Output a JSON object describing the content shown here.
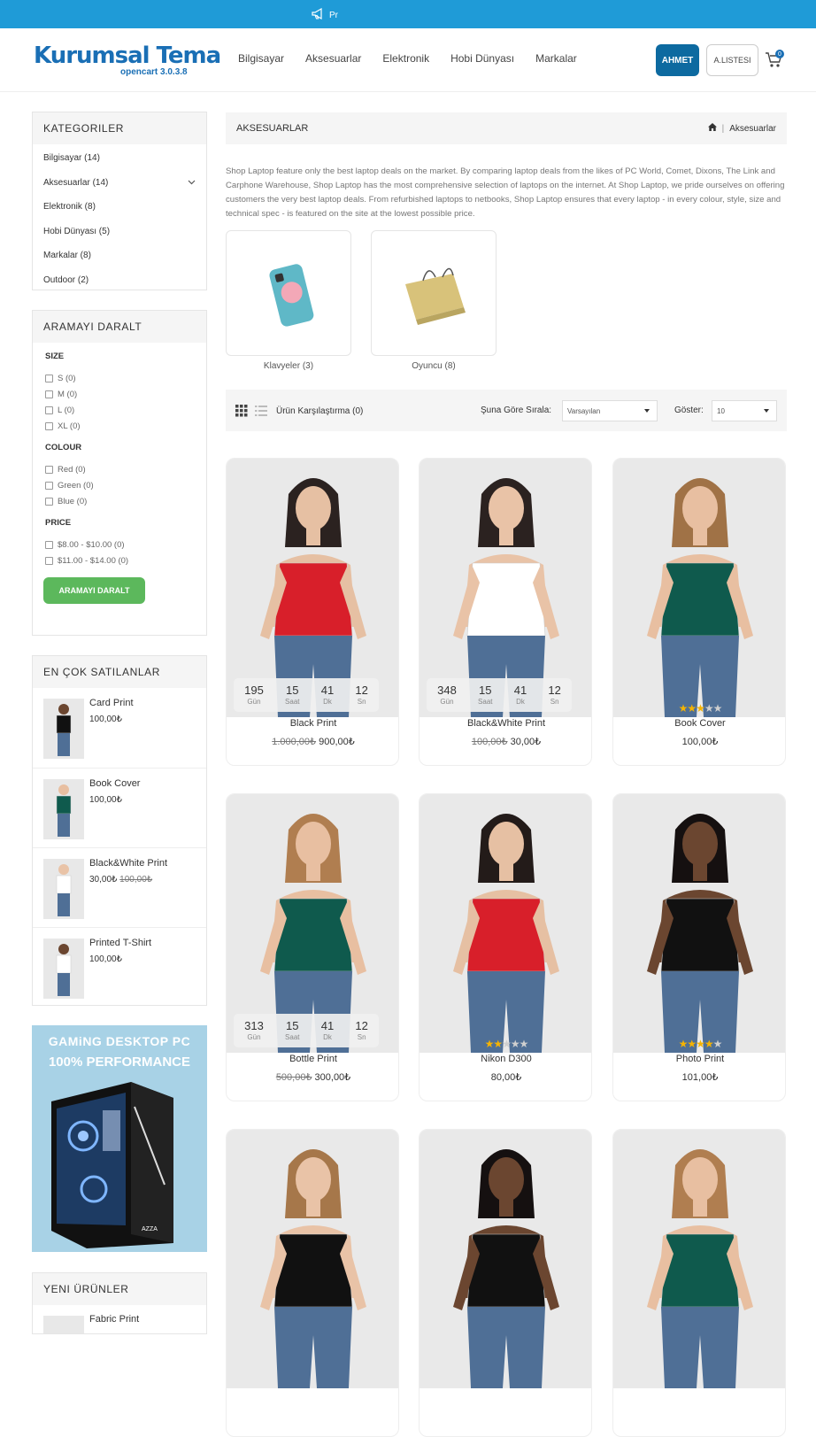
{
  "announcement": {
    "text": "Pr"
  },
  "logo": {
    "main": "Kurumsal Tema",
    "sub": "opencart 3.0.3.8"
  },
  "nav": [
    "Bilgisayar",
    "Aksesuarlar",
    "Elektronik",
    "Hobi Dünyası",
    "Markalar"
  ],
  "header": {
    "user_label": "AHMET",
    "wishlist_label": "A.LISTESI",
    "cart_count": "0"
  },
  "categories": {
    "title": "KATEGORILER",
    "items": [
      "Bilgisayar (14)",
      "Aksesuarlar (14)",
      "Elektronik (8)",
      "Hobi Dünyası (5)",
      "Markalar (8)",
      "Outdoor (2)"
    ]
  },
  "filter": {
    "title": "ARAMAYI DARALT",
    "groups": [
      {
        "title": "SIZE",
        "options": [
          "S (0)",
          "M (0)",
          "L (0)",
          "XL (0)"
        ]
      },
      {
        "title": "COLOUR",
        "options": [
          "Red (0)",
          "Green (0)",
          "Blue (0)"
        ]
      },
      {
        "title": "PRICE",
        "options": [
          "$8.00 - $10.00 (0)",
          "$11.00 - $14.00 (0)"
        ]
      }
    ],
    "button": "ARAMAYI DARALT"
  },
  "bestsellers": {
    "title": "EN ÇOK SATILANLAR",
    "items": [
      {
        "name": "Card Print",
        "price": "100,00₺",
        "old": ""
      },
      {
        "name": "Book Cover",
        "price": "100,00₺",
        "old": ""
      },
      {
        "name": "Black&White Print",
        "price": "30,00₺",
        "old": "100,00₺"
      },
      {
        "name": "Printed T-Shirt",
        "price": "100,00₺",
        "old": ""
      }
    ]
  },
  "banner": {
    "line1": "GAMiNG DESKTOP PC",
    "line2": "100% PERFORMANCE"
  },
  "new_products": {
    "title": "YENI ÜRÜNLER",
    "first": "Fabric Print"
  },
  "breadcrumb": {
    "title": "AKSESUARLAR",
    "current": "Aksesuarlar"
  },
  "description": "Shop Laptop feature only the best laptop deals on the market. By comparing laptop deals from the likes of PC World, Comet, Dixons, The Link and Carphone Warehouse, Shop Laptop has the most comprehensive selection of laptops on the internet. At Shop Laptop, we pride ourselves on offering customers the very best laptop deals. From refurbished laptops to netbooks, Shop Laptop ensures that every laptop - in every colour, style, size and technical spec - is featured on the site at the lowest possible price.",
  "subcategories": [
    "Klavyeler (3)",
    "Oyuncu (8)"
  ],
  "toolbar": {
    "compare": "Ürün Karşılaştırma (0)",
    "sort_label": "Şuna Göre Sırala:",
    "sort_value": "Varsayılan",
    "show_label": "Göster:",
    "show_value": "10"
  },
  "countdown_labels": [
    "Gün",
    "Saat",
    "Dk",
    "Sn"
  ],
  "products": [
    {
      "name": "Black Print",
      "old": "1.000,00₺",
      "price": "900,00₺",
      "countdown": [
        "195",
        "15",
        "41",
        "12"
      ],
      "rating": null,
      "top": "#e9e9e9",
      "shirt": "#d81f2a",
      "skin": "#e6c0a3",
      "hair": "#2b2220"
    },
    {
      "name": "Black&White Print",
      "old": "100,00₺",
      "price": "30,00₺",
      "countdown": [
        "348",
        "15",
        "41",
        "12"
      ],
      "rating": null,
      "top": "#e9e9e9",
      "shirt": "#ffffff",
      "skin": "#e9c3a7",
      "hair": "#2b2220"
    },
    {
      "name": "Book Cover",
      "old": "",
      "price": "100,00₺",
      "countdown": null,
      "rating": 3,
      "top": "#e9e9e9",
      "shirt": "#0f5a4d",
      "skin": "#e8bfa1",
      "hair": "#a07246"
    },
    {
      "name": "Bottle Print",
      "old": "500,00₺",
      "price": "300,00₺",
      "countdown": [
        "313",
        "15",
        "41",
        "12"
      ],
      "rating": null,
      "top": "#e9e9e9",
      "shirt": "#0f5a4d",
      "skin": "#e8bfa1",
      "hair": "#b07e50"
    },
    {
      "name": "Nikon D300",
      "old": "",
      "price": "80,00₺",
      "countdown": null,
      "rating": 2,
      "top": "#e9e9e9",
      "shirt": "#d81f2a",
      "skin": "#e6c0a3",
      "hair": "#231b19"
    },
    {
      "name": "Photo Print",
      "old": "",
      "price": "101,00₺",
      "countdown": null,
      "rating": 4,
      "top": "#e9e9e9",
      "shirt": "#111111",
      "skin": "#6b4630",
      "hair": "#151010"
    },
    {
      "name": "",
      "old": "",
      "price": "",
      "countdown": null,
      "rating": null,
      "top": "#e9e9e9",
      "shirt": "#111111",
      "skin": "#e9c3a7",
      "hair": "#a6774a"
    },
    {
      "name": "",
      "old": "",
      "price": "",
      "countdown": null,
      "rating": null,
      "top": "#e9e9e9",
      "shirt": "#111111",
      "skin": "#6b4630",
      "hair": "#151010"
    },
    {
      "name": "",
      "old": "",
      "price": "",
      "countdown": null,
      "rating": null,
      "top": "#e9e9e9",
      "shirt": "#0f5a4d",
      "skin": "#e8bfa1",
      "hair": "#b07e50"
    }
  ]
}
